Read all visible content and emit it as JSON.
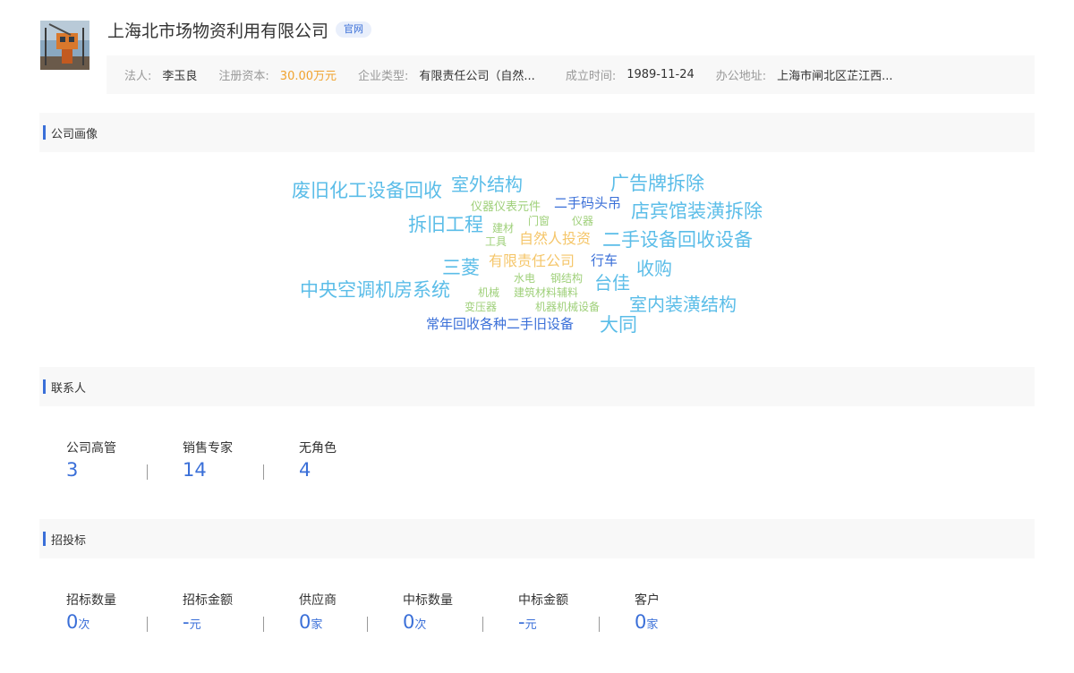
{
  "company": {
    "name": "上海北市场物资利用有限公司",
    "official_tag": "官网"
  },
  "info": [
    {
      "label": "法人:",
      "value": "李玉良"
    },
    {
      "label": "注册资本:",
      "value": "30.00万元",
      "highlight": true
    },
    {
      "label": "企业类型:",
      "value": "有限责任公司（自然..."
    },
    {
      "label": "成立时间:",
      "value": "1989-11-24"
    },
    {
      "label": "办公地址:",
      "value": "上海市闸北区芷江西..."
    }
  ],
  "sections": {
    "portrait": "公司画像",
    "contacts": "联系人",
    "bidding": "招投标"
  },
  "wordcloud": [
    {
      "text": "废旧化工设备回收",
      "color": "#5bbde8"
    },
    {
      "text": "室外结构",
      "color": "#5bbde8"
    },
    {
      "text": "广告牌拆除",
      "color": "#5bbde8"
    },
    {
      "text": "仪器仪表元件",
      "color": "#9fd07a"
    },
    {
      "text": "二手码头吊",
      "color": "#3a6fd8"
    },
    {
      "text": "店宾馆装潢拆除",
      "color": "#5bbde8"
    },
    {
      "text": "拆旧工程",
      "color": "#5bbde8"
    },
    {
      "text": "建材",
      "color": "#9fd07a"
    },
    {
      "text": "门窗",
      "color": "#9fd07a"
    },
    {
      "text": "仪器",
      "color": "#9fd07a"
    },
    {
      "text": "工具",
      "color": "#9fd07a"
    },
    {
      "text": "自然人投资",
      "color": "#f5c66a"
    },
    {
      "text": "二手设备回收设备",
      "color": "#5bbde8"
    },
    {
      "text": "三菱",
      "color": "#5bbde8"
    },
    {
      "text": "有限责任公司",
      "color": "#f5c66a"
    },
    {
      "text": "行车",
      "color": "#3a6fd8"
    },
    {
      "text": "收购",
      "color": "#5bbde8"
    },
    {
      "text": "水电",
      "color": "#9fd07a"
    },
    {
      "text": "钢结构",
      "color": "#9fd07a"
    },
    {
      "text": "中央空调机房系统",
      "color": "#5bbde8"
    },
    {
      "text": "机械",
      "color": "#9fd07a"
    },
    {
      "text": "建筑材料辅料",
      "color": "#9fd07a"
    },
    {
      "text": "台佳",
      "color": "#5bbde8"
    },
    {
      "text": "变压器",
      "color": "#9fd07a"
    },
    {
      "text": "机器机械设备",
      "color": "#9fd07a"
    },
    {
      "text": "室内装潢结构",
      "color": "#5bbde8"
    },
    {
      "text": "常年回收各种二手旧设备",
      "color": "#3a6fd8"
    },
    {
      "text": "大同",
      "color": "#5bbde8"
    }
  ],
  "contacts": [
    {
      "label": "公司高管",
      "value": "3"
    },
    {
      "label": "销售专家",
      "value": "14"
    },
    {
      "label": "无角色",
      "value": "4"
    }
  ],
  "bidding": [
    {
      "label": "招标数量",
      "value": "0",
      "unit": "次"
    },
    {
      "label": "招标金额",
      "value": "-",
      "unit": "元"
    },
    {
      "label": "供应商",
      "value": "0",
      "unit": "家"
    },
    {
      "label": "中标数量",
      "value": "0",
      "unit": "次"
    },
    {
      "label": "中标金额",
      "value": "-",
      "unit": "元"
    },
    {
      "label": "客户",
      "value": "0",
      "unit": "家"
    }
  ]
}
